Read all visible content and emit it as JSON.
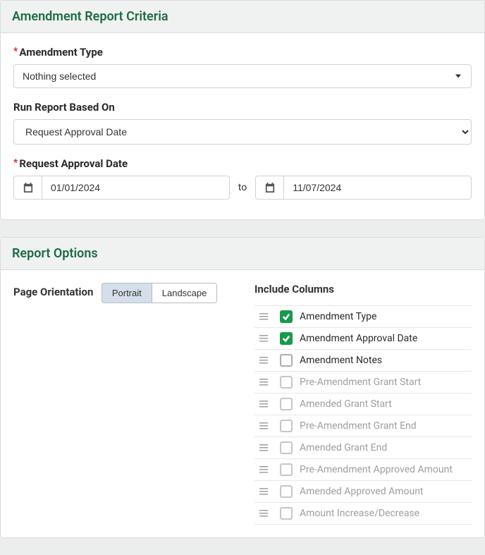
{
  "criteria": {
    "header": "Amendment Report Criteria",
    "amendment_type_label": "Amendment Type",
    "amendment_type_value": "Nothing selected",
    "run_based_label": "Run Report Based On",
    "run_based_value": "Request Approval Date",
    "date_label": "Request Approval Date",
    "date_from": "01/01/2024",
    "to_label": "to",
    "date_to": "11/07/2024"
  },
  "options": {
    "header": "Report Options",
    "orientation_label": "Page Orientation",
    "orientation_options": {
      "portrait": "Portrait",
      "landscape": "Landscape"
    },
    "orientation_selected": "portrait",
    "columns_label": "Include Columns",
    "columns": [
      {
        "label": "Amendment Type",
        "checked": true,
        "enabled": true
      },
      {
        "label": "Amendment Approval Date",
        "checked": true,
        "enabled": true
      },
      {
        "label": "Amendment Notes",
        "checked": false,
        "enabled": true
      },
      {
        "label": "Pre-Amendment Grant Start",
        "checked": false,
        "enabled": false
      },
      {
        "label": "Amended Grant Start",
        "checked": false,
        "enabled": false
      },
      {
        "label": "Pre-Amendment Grant End",
        "checked": false,
        "enabled": false
      },
      {
        "label": "Amended Grant End",
        "checked": false,
        "enabled": false
      },
      {
        "label": "Pre-Amendment Approved Amount",
        "checked": false,
        "enabled": false
      },
      {
        "label": "Amended Approved Amount",
        "checked": false,
        "enabled": false
      },
      {
        "label": "Amount Increase/Decrease",
        "checked": false,
        "enabled": false
      }
    ]
  }
}
